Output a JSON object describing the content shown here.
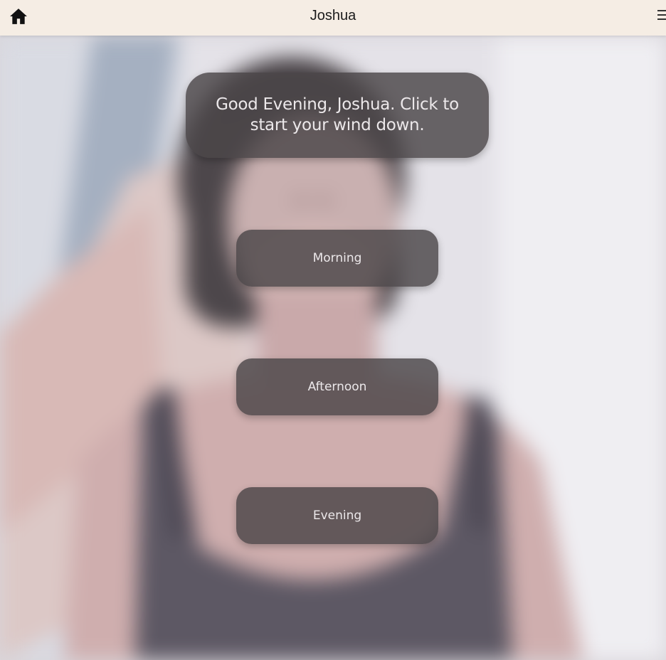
{
  "header": {
    "title": "Joshua",
    "home_icon": "home-icon",
    "menu_icon": "hamburger-menu-icon"
  },
  "main": {
    "greeting": "Good Evening, Joshua. Click to start your wind down.",
    "buttons": [
      {
        "label": "Morning"
      },
      {
        "label": "Afternoon"
      },
      {
        "label": "Evening"
      }
    ]
  },
  "colors": {
    "topbar_background": "#f5ede4",
    "card_background": "#4b4648",
    "card_text": "#ece8ea"
  }
}
